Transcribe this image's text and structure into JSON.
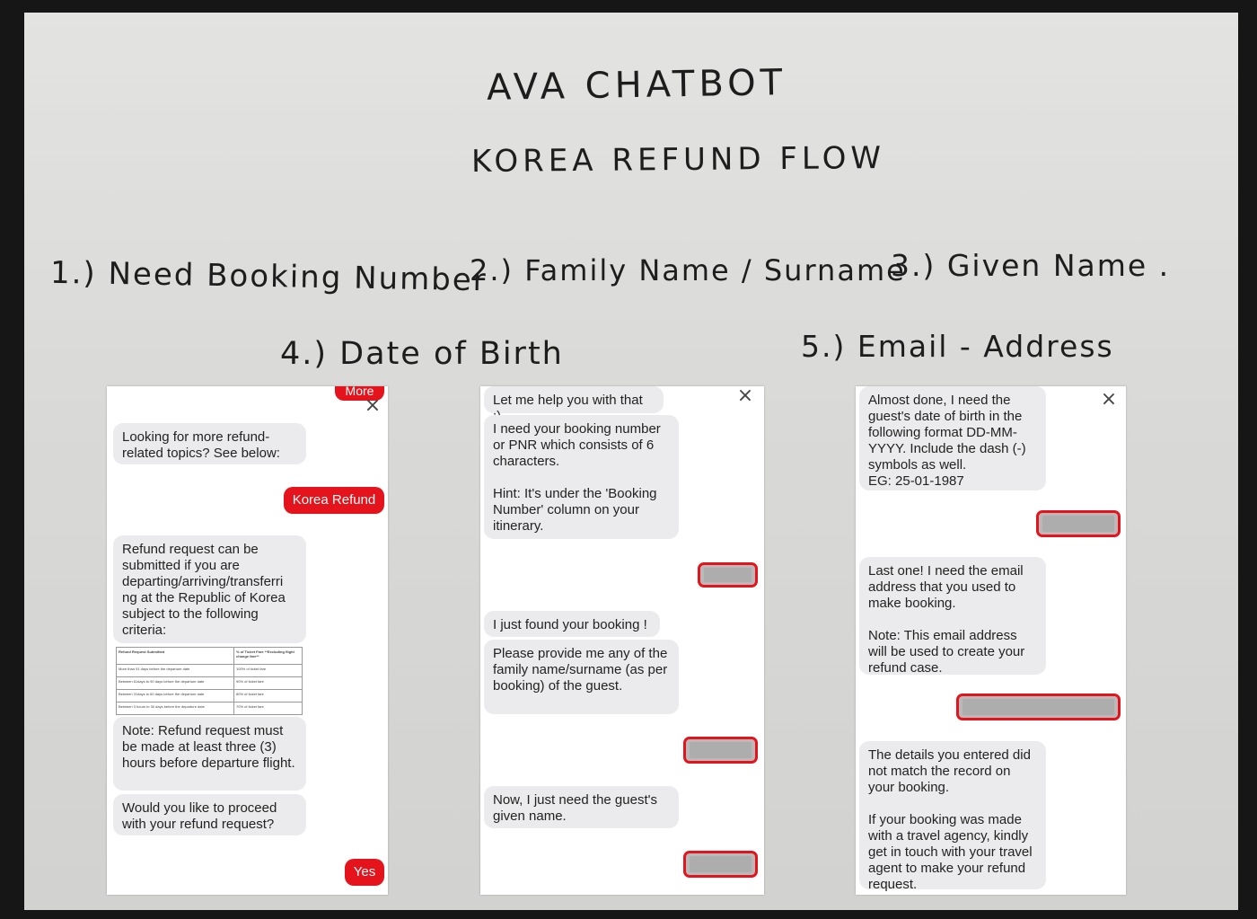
{
  "whiteboard": {
    "title_line1": "AVA CHATBOT",
    "title_line2": "KOREA   REFUND  FLOW",
    "steps": [
      "1.) Need Booking Number",
      "2.) Family Name / Surname",
      "3.) Given Name .",
      "4.) Date of Birth",
      "5.) Email - Address"
    ]
  },
  "screen1": {
    "more_button": "More",
    "close_icon": "×",
    "bot_topics": "Looking for more refund-\nrelated topics? See below:",
    "user_korea_refund": "Korea Refund",
    "bot_refund_request": "Refund request can be submitted if you are departing/arriving/transferri ng at the Republic of Korea subject to the following criteria:",
    "table": {
      "headers": [
        "Refund Request Submitted",
        "% of Ticket Fare\n**Excluding flight change fare**"
      ],
      "rows": [
        [
          "More than 91 days before the departure date",
          "100% of ticket fare"
        ],
        [
          "Between 61days to 90 days before the departure date",
          "90% of ticket fare"
        ],
        [
          "Between 31days to 60 days before the departure date",
          "80% of ticket fare"
        ],
        [
          "Between 3 hours to 30 days before the departure date",
          "70% of ticket fare"
        ]
      ]
    },
    "bot_note": "Note: Refund request must be made at least three (3) hours before departure flight.",
    "bot_proceed": "Would you like to proceed with your refund request?",
    "user_yes": "Yes"
  },
  "screen2": {
    "close_icon": "×",
    "bot_help": "Let me help you with that :)",
    "bot_booking": "I need your booking number or PNR which consists of 6 characters.\n\nHint: It's under the 'Booking Number' column on your itinerary.",
    "bot_found": "I just found your booking !",
    "bot_family": "Please provide me any of the family name/surname (as per booking) of the guest.",
    "bot_given": "Now, I just need the guest's given name."
  },
  "screen3": {
    "close_icon": "×",
    "bot_dob": "Almost done, I need the guest's date of birth in the following format DD-MM-YYYY. Include the dash (-) symbols as well.\nEG: 25-01-1987",
    "bot_email": "Last one! I need the email address that you used to make booking.\n\nNote: This email address will be used to create your refund case.",
    "bot_mismatch": "The details you entered did not match the record on your booking.\n\nIf your booking was made with a travel agency, kindly get in touch with your travel agent to make your refund request."
  },
  "colors": {
    "accent_red": "#e5141c",
    "bot_bubble": "#ebebed",
    "board": "#dcdcda"
  }
}
